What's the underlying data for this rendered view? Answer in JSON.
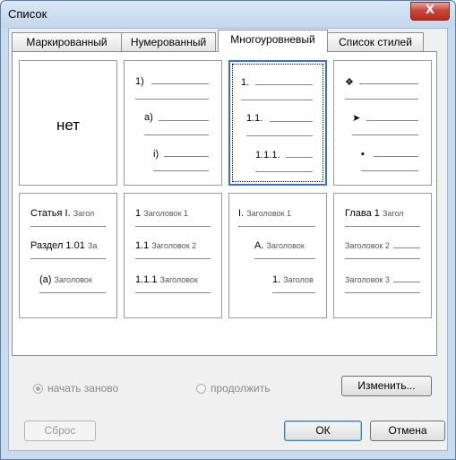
{
  "window": {
    "title": "Список",
    "close_label": "X"
  },
  "tabs": [
    {
      "label": "Маркированный",
      "active": false
    },
    {
      "label": "Нумерованный",
      "active": false
    },
    {
      "label": "Многоуровневый",
      "active": true
    },
    {
      "label": "Список стилей",
      "active": false
    }
  ],
  "gallery": {
    "none_label": "нет",
    "row1": {
      "c2": {
        "l1": "1)",
        "l2": "a)",
        "l3": "i)"
      },
      "c3": {
        "l1": "1.",
        "l2": "1.1.",
        "l3": "1.1.1."
      },
      "c4": {
        "l1": "❖",
        "l2": "➤",
        "l3": "▪"
      }
    },
    "row2": {
      "c1": {
        "l1a": "Статья I.",
        "l1b": "Загол",
        "l2a": "Раздел 1.01",
        "l2b": "За",
        "l3a": "(a)",
        "l3b": "Заголовок"
      },
      "c2": {
        "l1a": "1",
        "l1b": "Заголовок 1",
        "l2a": "1.1",
        "l2b": "Заголовок 2",
        "l3a": "1.1.1",
        "l3b": "Заголовок"
      },
      "c3": {
        "l1a": "I.",
        "l1b": "Заголовок 1",
        "l2a": "A.",
        "l2b": "Заголовок",
        "l3a": "1.",
        "l3b": "Заголов"
      },
      "c4": {
        "l1a": "Глава 1",
        "l1b": "Загол",
        "l2a": "",
        "l2b": "Заголовок 2",
        "l3a": "",
        "l3b": "Заголовок 3"
      }
    },
    "selected_cell": "row1.c3"
  },
  "options": {
    "restart_label": "начать заново",
    "restart_selected": true,
    "continue_label": "продолжить",
    "continue_selected": false
  },
  "buttons": {
    "modify": "Изменить...",
    "reset": "Сброс",
    "ok": "ОК",
    "cancel": "Отмена"
  },
  "colors": {
    "title_bg": "#c9dbee",
    "close": "#c8483a",
    "selection": "#3d6fc4"
  }
}
